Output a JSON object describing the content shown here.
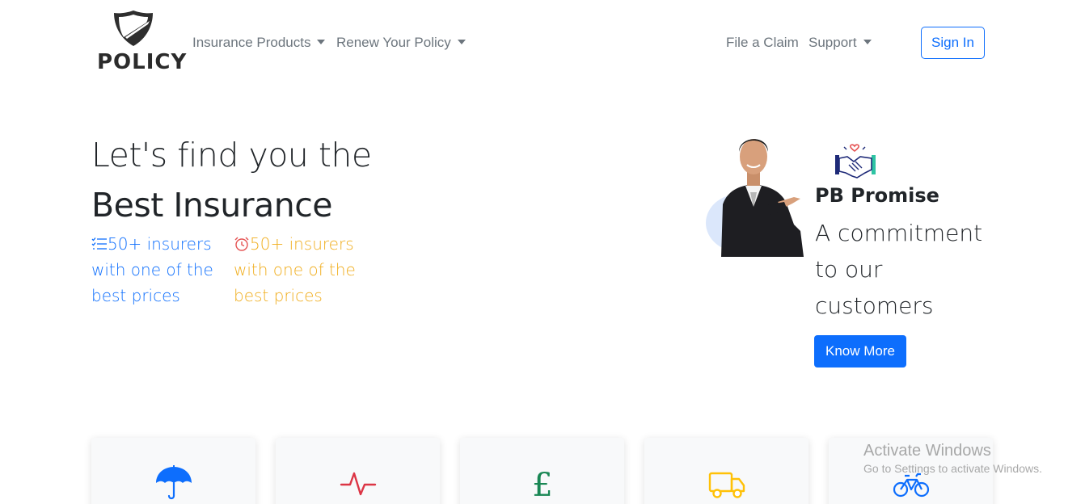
{
  "brand": {
    "name": "POLICY"
  },
  "nav": {
    "insurance_products": "Insurance Products",
    "renew_policy": "Renew Your Policy",
    "file_claim": "File a Claim",
    "support": "Support",
    "sign_in": "Sign In"
  },
  "hero": {
    "line1": "Let's find you the",
    "line2": "Best Insurance",
    "features": [
      {
        "icon": "list-icon",
        "text": "50+ insurers with one of the best prices",
        "color": "#0d6efd"
      },
      {
        "icon": "alarm-clock-icon",
        "text": "50+ insurers with one of the best prices",
        "color": "#f0ad1c"
      }
    ]
  },
  "promise": {
    "title": "PB Promise",
    "text": "A commitment to our customers",
    "button": "Know More"
  },
  "cards": [
    {
      "icon": "umbrella-icon",
      "color": "#0d6efd"
    },
    {
      "icon": "heartbeat-icon",
      "color": "#dc3545"
    },
    {
      "icon": "pound-icon",
      "color": "#198754"
    },
    {
      "icon": "truck-icon",
      "color": "#ffc107"
    },
    {
      "icon": "bicycle-icon",
      "color": "#0d6efd"
    }
  ],
  "watermark": {
    "title": "Activate Windows",
    "subtitle": "Go to Settings to activate Windows."
  }
}
